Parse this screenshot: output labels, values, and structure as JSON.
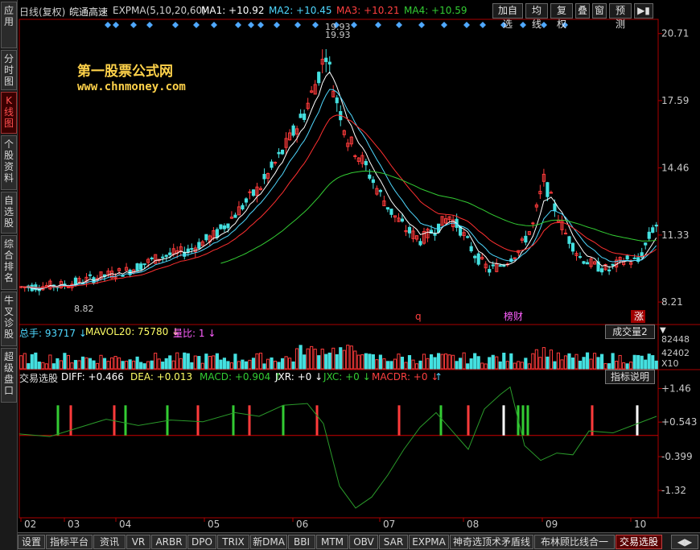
{
  "sidebar": {
    "items": [
      {
        "label": "应用",
        "active": false
      },
      {
        "label": "分时图",
        "active": false
      },
      {
        "label": "K线图",
        "active": true
      },
      {
        "label": "个股资料",
        "active": false
      },
      {
        "label": "自选股",
        "active": false
      },
      {
        "label": "综合排名",
        "active": false
      },
      {
        "label": "牛叉诊股",
        "active": false
      },
      {
        "label": "超级盘口",
        "active": false
      }
    ]
  },
  "header": {
    "period": "日线(复权)",
    "stock_name": "皖通高速",
    "indicator": "EXPMA(5,10,20,60)",
    "ma1": "MA1: +10.92",
    "ma2": "MA2: +10.45",
    "ma3": "MA3: +10.21",
    "ma4": "MA4: +10.59",
    "buttons": [
      "加自选",
      "均线",
      "复权",
      "叠",
      "窗",
      "预测"
    ]
  },
  "colors": {
    "up": "#ff3b3b",
    "down": "#44e0e0",
    "ma1": "#ffffff",
    "ma2": "#4fd8ff",
    "ma3": "#ff3030",
    "ma4": "#33cc33",
    "axis": "#aa0000",
    "label_text": "#c8c8c8"
  },
  "watermark": {
    "line1": "第一股票公式网",
    "line2": "www.chnmoney.com"
  },
  "price_axis": [
    "20.71",
    "17.59",
    "14.46",
    "11.33",
    "8.21"
  ],
  "price_annotations": {
    "high1": "19.93",
    "high2": "19.93",
    "low": "8.82"
  },
  "event_markers": [
    {
      "label": "q",
      "color": "#ff4040"
    },
    {
      "label": "榜财",
      "color": "#ff60ff"
    },
    {
      "label": "涨",
      "color": "#ffffff"
    }
  ],
  "volume_header": {
    "total": "总手: 93717",
    "mavol": "MAVOL20: 75780",
    "ratio": "量比: 1",
    "dropdown": "成交量2"
  },
  "volume_axis": [
    "82448",
    "42402",
    "X10"
  ],
  "macd_header": {
    "name": "交易选股",
    "diff": "DIFF: +0.466",
    "dea": "DEA: +0.013",
    "macd": "MACD: +0.904",
    "jxr": "JXR: +0",
    "jxc": "JXC: +0",
    "macdr": "MACDR: +0",
    "help_button": "指标说明"
  },
  "macd_axis": [
    "+1.46",
    "+0.543",
    "-0.399",
    "-1.32"
  ],
  "x_axis_months": [
    "02",
    "03",
    "04",
    "05",
    "06",
    "07",
    "08",
    "09",
    "10"
  ],
  "tabs": {
    "items": [
      {
        "label": "设置",
        "active": false
      },
      {
        "label": "指标平台",
        "active": false
      },
      {
        "label": "资讯",
        "active": false
      },
      {
        "label": "VR",
        "active": false
      },
      {
        "label": "ARBR",
        "active": false
      },
      {
        "label": "DPO",
        "active": false
      },
      {
        "label": "TRIX",
        "active": false
      },
      {
        "label": "新DMA",
        "active": false
      },
      {
        "label": "BBI",
        "active": false
      },
      {
        "label": "MTM",
        "active": false
      },
      {
        "label": "OBV",
        "active": false
      },
      {
        "label": "SAR",
        "active": false
      },
      {
        "label": "EXPMA",
        "active": false
      },
      {
        "label": "神奇选顶术矛盾线",
        "active": false
      },
      {
        "label": "布林顾比线合一",
        "active": false
      },
      {
        "label": "交易选股",
        "active": true
      }
    ]
  }
}
